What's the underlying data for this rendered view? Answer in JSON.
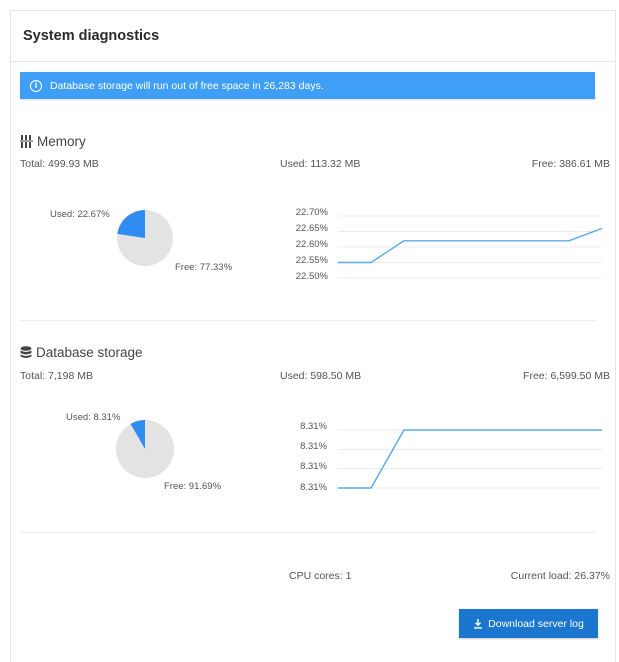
{
  "page_title": "System diagnostics",
  "alert": {
    "icon": "info-icon",
    "text": "Database storage will run out of free space in 26,283 days."
  },
  "memory": {
    "icon": "memory-chip-icon",
    "title": "Memory",
    "total": "Total: 499.93 MB",
    "used": "Used: 113.32 MB",
    "free": "Free: 386.61 MB",
    "pie": {
      "used_label": "Used: 22.67%",
      "free_label": "Free: 77.33%",
      "used_fraction": 0.2267
    },
    "chart_ticks": [
      "22.70%",
      "22.65%",
      "22.60%",
      "22.55%",
      "22.50%"
    ]
  },
  "database": {
    "icon": "database-icon",
    "title": "Database storage",
    "total": "Total: 7,198 MB",
    "used": "Used: 598.50 MB",
    "free": "Free: 6,599.50 MB",
    "pie": {
      "used_label": "Used: 8.31%",
      "free_label": "Free: 91.69%",
      "used_fraction": 0.0831
    },
    "chart_ticks": [
      "8.31%",
      "8.31%",
      "8.31%",
      "8.31%"
    ]
  },
  "footer": {
    "cpu_cores": "CPU cores: 1",
    "current_load": "Current load: 26.37%",
    "download_label": "Download server log",
    "download_icon": "download-icon"
  },
  "colors": {
    "accent": "#3f9ef5",
    "button": "#1a76cf",
    "pie_used": "#2f8cf0",
    "pie_free": "#e3e3e3",
    "line": "#5aa8f0"
  },
  "chart_data": [
    {
      "type": "line",
      "series": [
        {
          "values": [
            22.55,
            22.55,
            22.62,
            22.62,
            22.62,
            22.62,
            22.62,
            22.62,
            22.66
          ]
        }
      ],
      "yticks": [
        "22.70%",
        "22.65%",
        "22.60%",
        "22.55%",
        "22.50%"
      ],
      "ylim": [
        22.5,
        22.7
      ],
      "grid": true
    },
    {
      "type": "line",
      "series": [
        {
          "values": [
            0,
            0,
            1,
            1,
            1,
            1,
            1,
            1,
            1
          ]
        }
      ],
      "yticks": [
        "8.31%",
        "8.31%",
        "8.31%",
        "8.31%"
      ],
      "ylim": [
        0,
        1
      ],
      "grid": true
    }
  ]
}
